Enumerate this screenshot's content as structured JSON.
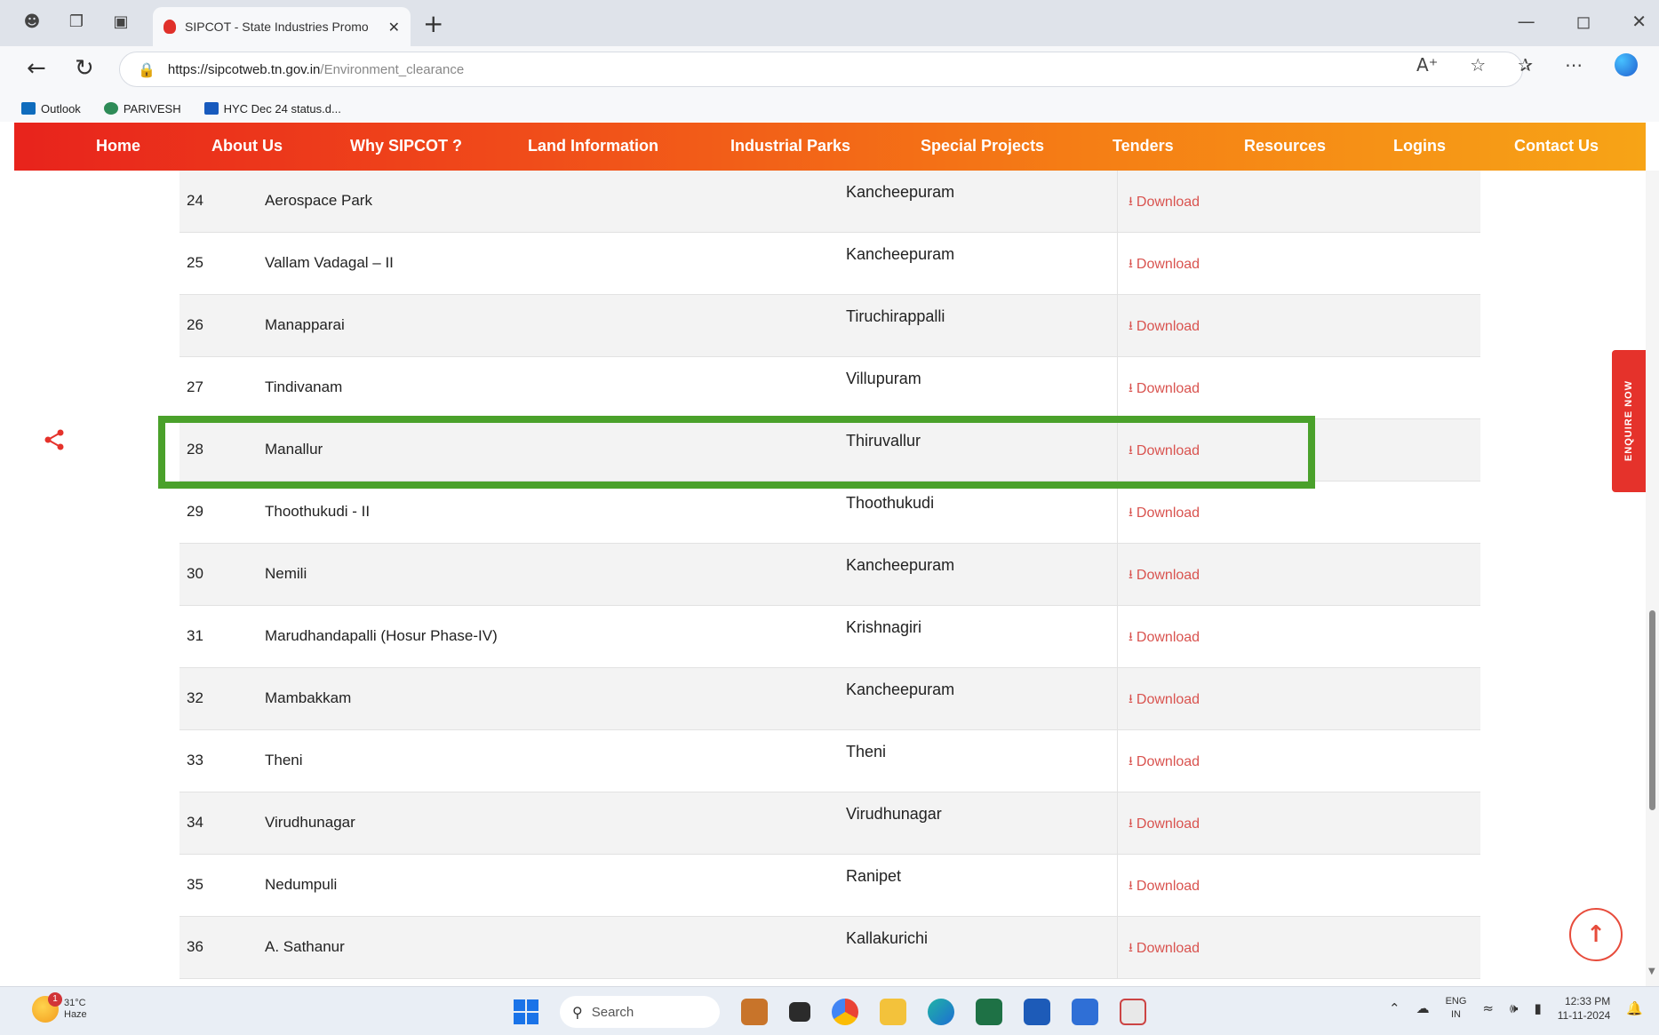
{
  "browser": {
    "tab_title": "SIPCOT - State Industries Promo",
    "tab_close": "✕",
    "new_tab": "+",
    "url_host": "https://sipcotweb.tn.gov.in",
    "url_path": "/Environment_clearance",
    "favorites": [
      {
        "label": "Outlook",
        "color": "#0f6cbd"
      },
      {
        "label": "PARIVESH",
        "color": "#2e8b57"
      },
      {
        "label": "HYC Dec 24 status.d...",
        "color": "#185abd"
      }
    ]
  },
  "site_nav": [
    {
      "label": "Home"
    },
    {
      "label": "About Us"
    },
    {
      "label": "Why SIPCOT ?"
    },
    {
      "label": "Land Information"
    },
    {
      "label": "Industrial Parks"
    },
    {
      "label": "Special Projects"
    },
    {
      "label": "Tenders"
    },
    {
      "label": "Resources"
    },
    {
      "label": "Logins"
    },
    {
      "label": "Contact Us"
    }
  ],
  "table": {
    "download_label": "Download",
    "rows": [
      {
        "num": "24",
        "name": "Aerospace Park",
        "district": "Kancheepuram"
      },
      {
        "num": "25",
        "name": "Vallam Vadagal – II",
        "district": "Kancheepuram"
      },
      {
        "num": "26",
        "name": "Manapparai",
        "district": "Tiruchirappalli"
      },
      {
        "num": "27",
        "name": "Tindivanam",
        "district": "Villupuram"
      },
      {
        "num": "28",
        "name": "Manallur",
        "district": "Thiruvallur"
      },
      {
        "num": "29",
        "name": "Thoothukudi - II",
        "district": "Thoothukudi"
      },
      {
        "num": "30",
        "name": "Nemili",
        "district": "Kancheepuram"
      },
      {
        "num": "31",
        "name": "Marudhandapalli (Hosur Phase-IV)",
        "district": "Krishnagiri"
      },
      {
        "num": "32",
        "name": "Mambakkam",
        "district": "Kancheepuram"
      },
      {
        "num": "33",
        "name": "Theni",
        "district": "Theni"
      },
      {
        "num": "34",
        "name": "Virudhunagar",
        "district": "Virudhunagar"
      },
      {
        "num": "35",
        "name": "Nedumpuli",
        "district": "Ranipet"
      },
      {
        "num": "36",
        "name": "A. Sathanur",
        "district": "Kallakurichi"
      }
    ]
  },
  "enquire_label": "ENQUIRE NOW",
  "taskbar": {
    "weather_temp": "31°C",
    "weather_cond": "Haze",
    "weather_badge": "1",
    "search_label": "Search",
    "lang_1": "ENG",
    "lang_2": "IN",
    "time": "12:33 PM",
    "date": "11-11-2024"
  },
  "colors": {
    "accent_red": "#e5322b",
    "highlight_green": "#4aa12b",
    "download_red": "#d9534f"
  }
}
